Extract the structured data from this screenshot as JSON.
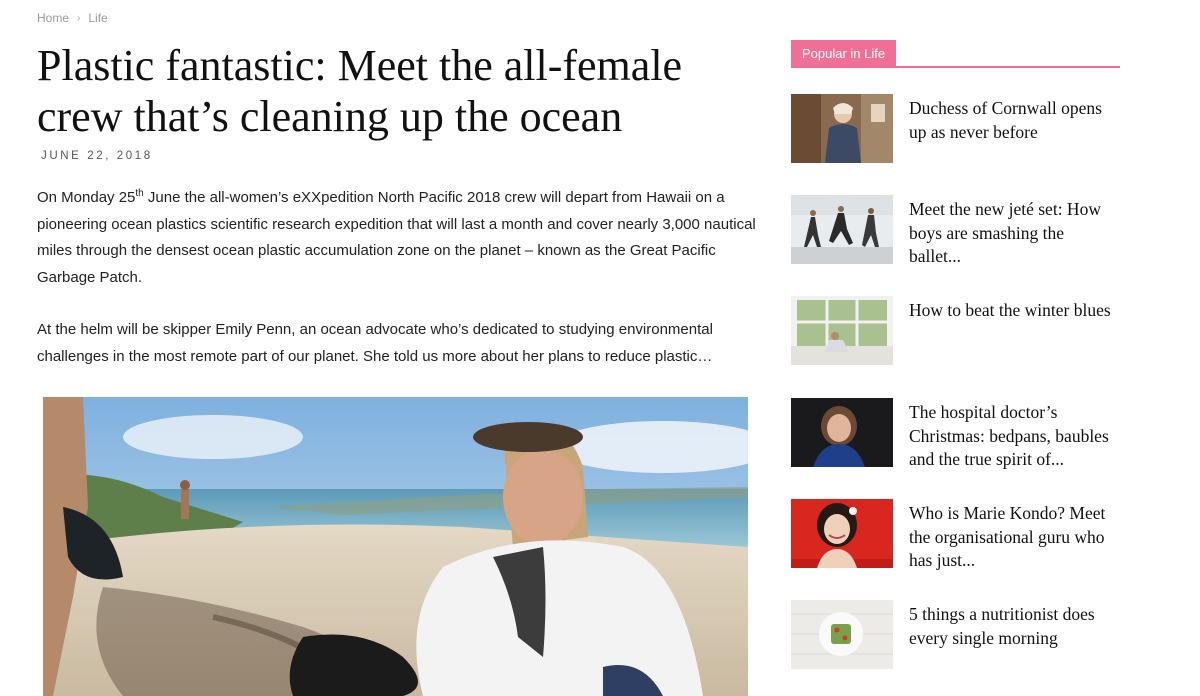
{
  "breadcrumb": {
    "home": "Home",
    "separator": "›",
    "current": "Life"
  },
  "article": {
    "title": "Plastic fantastic: Meet the all-female crew that’s cleaning up the ocean",
    "date": "JUNE 22, 2018",
    "p1_before": "On Monday 25",
    "p1_sup": "th",
    "p1_after": " June the all-women’s eXXpedition North Pacific 2018 crew will depart from Hawaii on a pioneering ocean plastics scientific research expedition that will last a month and cover nearly 3,000 nautical miles through the densest ocean plastic accumulation zone on the planet – known as the Great Pacific Garbage Patch.",
    "p2": "At the helm will be skipper Emily Penn, an ocean advocate who’s dedicated to studying environmental challenges in the most remote part of our planet. She told us more about her plans to reduce plastic…"
  },
  "sidebar": {
    "heading": "Popular in Life",
    "accent": "#ef6f97",
    "items": [
      {
        "title": "Duchess of Cornwall opens up as never before",
        "thumb": "duchess-photo"
      },
      {
        "title": "Meet the new jeté set: How boys are smashing the ballet...",
        "thumb": "ballet-photo"
      },
      {
        "title": "How to beat the winter blues",
        "thumb": "window-seat-photo"
      },
      {
        "title": "The hospital doctor’s Christmas: bedpans, baubles and the true spirit of...",
        "thumb": "doctor-photo"
      },
      {
        "title": "Who is Marie Kondo? Meet the organisational guru who has just...",
        "thumb": "marie-kondo-photo"
      },
      {
        "title": "5 things a nutritionist does every single morning",
        "thumb": "avocado-toast-photo"
      }
    ]
  }
}
